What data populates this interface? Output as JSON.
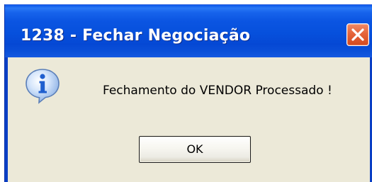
{
  "window": {
    "title": "1238 - Fechar Negociação"
  },
  "dialog": {
    "icon": "info-icon",
    "message": "Fechamento do VENDOR Processado !",
    "ok_label": "OK"
  },
  "colors": {
    "titlebar": "#0653dc",
    "close_button": "#e05a2e",
    "client_background": "#ece9d8",
    "info_icon": "#1f5fcf"
  }
}
